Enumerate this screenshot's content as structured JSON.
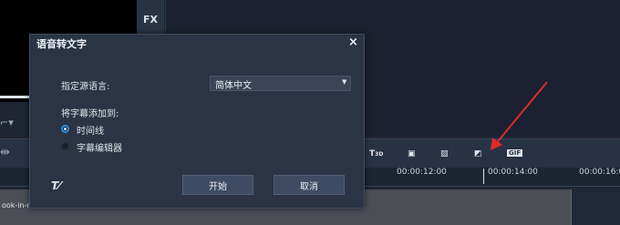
{
  "background": {
    "fx_label": "FX",
    "clip_label": "ook-in-na",
    "timeline": {
      "ticks": [
        "00:00:12:00",
        "00:00:14:00",
        "00:00:16:00"
      ]
    },
    "toolbar_icons": [
      "T3D",
      "mask-icon",
      "image-icon",
      "split-screen-icon",
      "GIF"
    ]
  },
  "dialog": {
    "title": "语音转文字",
    "close_symbol": "×",
    "source_language_label": "指定源语言:",
    "source_language_value": "简体中文",
    "add_subtitle_to_label": "将字幕添加到:",
    "options": [
      {
        "label": "时间线",
        "selected": true
      },
      {
        "label": "字幕编辑器",
        "selected": false
      }
    ],
    "start_button": "开始",
    "cancel_button": "取消"
  },
  "colors": {
    "accent": "#2a8fe0",
    "annotation_arrow": "#e02a2a",
    "dialog_bg": "#2b3445"
  }
}
